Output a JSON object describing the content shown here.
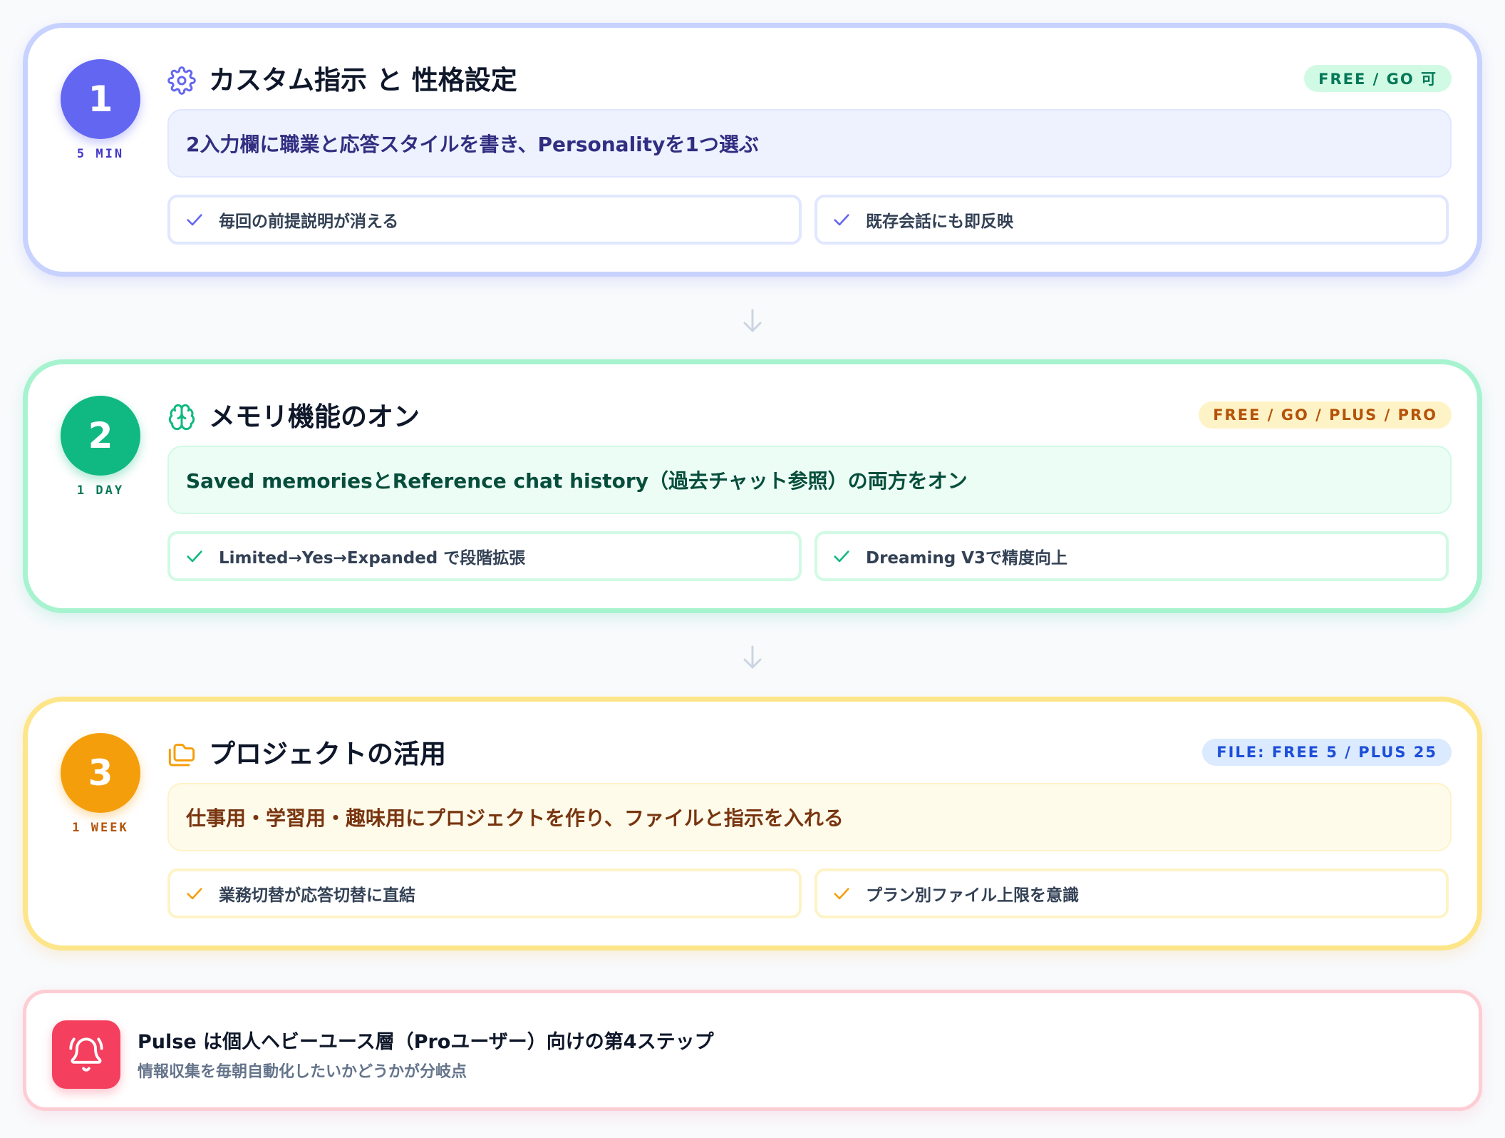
{
  "steps": [
    {
      "number": "1",
      "duration": "5 MIN",
      "icon": "gear-icon",
      "title": "カスタム指示 と 性格設定",
      "badge": "FREE / GO 可",
      "main": "2入力欄に職業と応答スタイルを書き、Personalityを1つ選ぶ",
      "points": [
        "毎回の前提説明が消える",
        "既存会話にも即反映"
      ],
      "accent": "#6366f1"
    },
    {
      "number": "2",
      "duration": "1 DAY",
      "icon": "brain-icon",
      "title": "メモリ機能のオン",
      "badge": "FREE / GO / PLUS / PRO",
      "main": "Saved memoriesとReference chat history（過去チャット参照）の両方をオン",
      "points": [
        "Limited→Yes→Expanded で段階拡張",
        "Dreaming V3で精度向上"
      ],
      "accent": "#10b981"
    },
    {
      "number": "3",
      "duration": "1 WEEK",
      "icon": "folders-icon",
      "title": "プロジェクトの活用",
      "badge": "FILE: FREE 5 / PLUS 25",
      "main": "仕事用・学習用・趣味用にプロジェクトを作り、ファイルと指示を入れる",
      "points": [
        "業務切替が応答切替に直結",
        "プラン別ファイル上限を意識"
      ],
      "accent": "#f59e0b"
    }
  ],
  "pulse": {
    "icon": "bell-ring-icon",
    "title": "Pulse は個人ヘビーユース層（Proユーザー）向けの第4ステップ",
    "subtitle": "情報収集を毎朝自動化したいかどうかが分岐点",
    "accent": "#f43f5e"
  }
}
